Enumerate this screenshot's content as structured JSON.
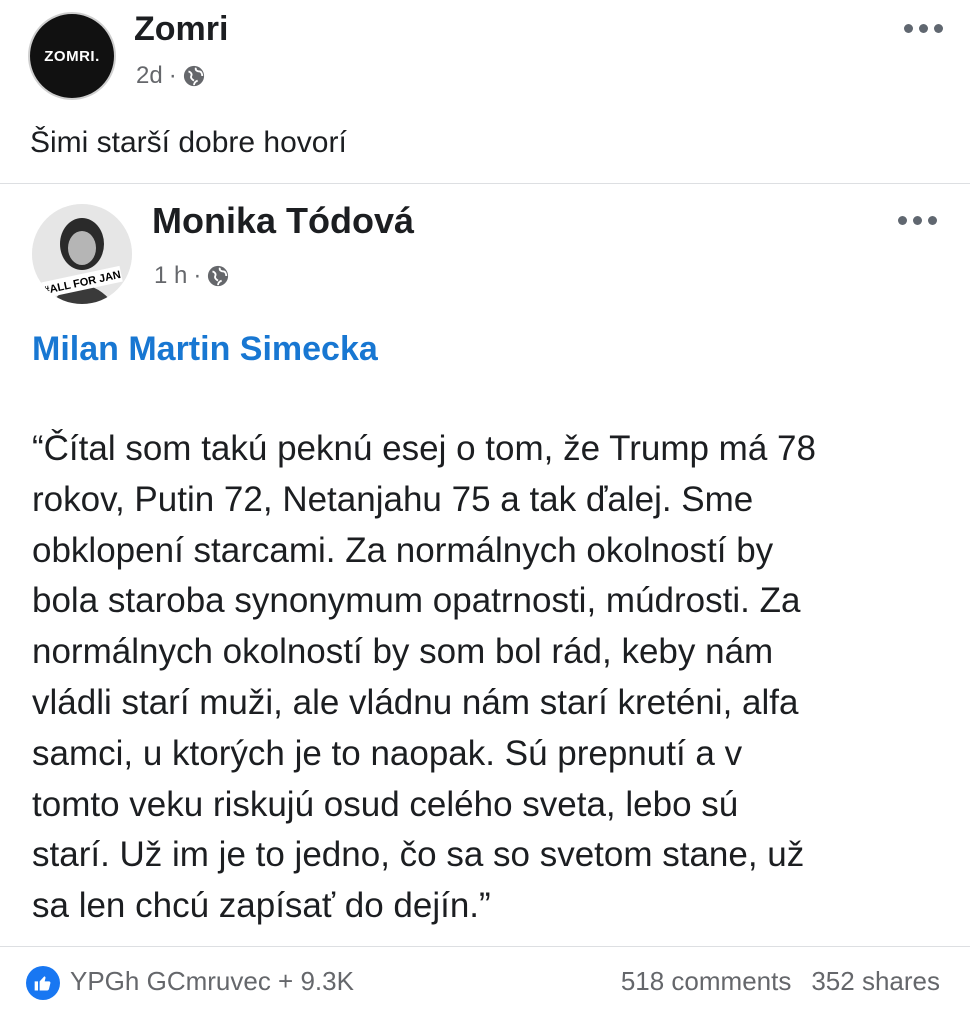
{
  "post": {
    "page_name": "Zomri",
    "avatar_text": "ZOMRI.",
    "time": "2d",
    "text": "Šimi starší dobre hovorí"
  },
  "shared": {
    "author": "Monika Tódová",
    "avatar_badge": "#ALL FOR JAN",
    "time": "1 h",
    "link_title": "Milan Martin Simecka",
    "quote": "“Čítal som takú peknú esej o tom, že Trump má 78\nrokov, Putin 72, Netanjahu 75 a tak ďalej. Sme\nobklopení starcami. Za normálnych okolností by\nbola staroba synonymum opatrnosti, múdrosti. Za\nnormálnych okolností by som bol rád, keby nám\nvládli starí muži, ale vládnu nám starí kreténi, alfa\nsamci, u ktorých je to naopak. Sú prepnutí a v\ntomto veku riskujú osud celého sveta, lebo sú\nstarí. Už im je to jedno, čo sa so svetom stane, už\nsa len chcú zapísať do dejín.”"
  },
  "footer": {
    "reactions": "YPGh GCmruvec + 9.3K",
    "comments": "518 comments",
    "shares": "352 shares"
  },
  "colors": {
    "link": "#1877d2",
    "like": "#1877f2",
    "meta": "#65676b"
  }
}
